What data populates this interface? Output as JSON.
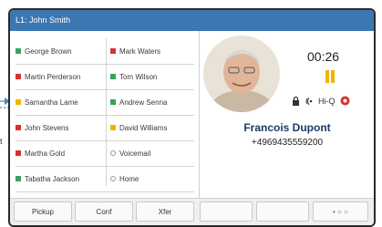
{
  "titlebar": {
    "line_label": "L1: John Smith"
  },
  "blf_left": [
    {
      "label": "George Brown",
      "color": "#3aa35a"
    },
    {
      "label": "Martin Perderson",
      "color": "#d93030"
    },
    {
      "label": "Samantha Lame",
      "color": "#f2b400"
    },
    {
      "label": "John Stevens",
      "color": "#d93030"
    },
    {
      "label": "Martha Gold",
      "color": "#d93030"
    },
    {
      "label": "Tabatha Jackson",
      "color": "#3aa35a"
    }
  ],
  "blf_right": [
    {
      "label": "Mark Waters",
      "color": "#d93030",
      "indicator": "square"
    },
    {
      "label": "Tom Wilson",
      "color": "#3aa35a",
      "indicator": "square"
    },
    {
      "label": "Andrew Senna",
      "color": "#3aa35a",
      "indicator": "square"
    },
    {
      "label": "David Williams",
      "color": "#f2b400",
      "indicator": "square"
    },
    {
      "label": "Voicemail",
      "indicator": "circle"
    },
    {
      "label": "Home",
      "indicator": "circle"
    }
  ],
  "call": {
    "timer": "00:26",
    "status_icon": "pause-icon",
    "hiq_label": "Hi-Q",
    "caller_name": "Francois Dupont",
    "caller_number": "+4969435559200"
  },
  "softkeys": [
    "Pickup",
    "Conf",
    "Xfer",
    "",
    "",
    ""
  ],
  "page_indicator_left": "• ○",
  "page_indicator_right": "• ○ ○",
  "annotation_text": "t",
  "colors": {
    "accent": "#3b77b3",
    "green": "#3aa35a",
    "red": "#d93030",
    "yellow": "#f2b400"
  }
}
